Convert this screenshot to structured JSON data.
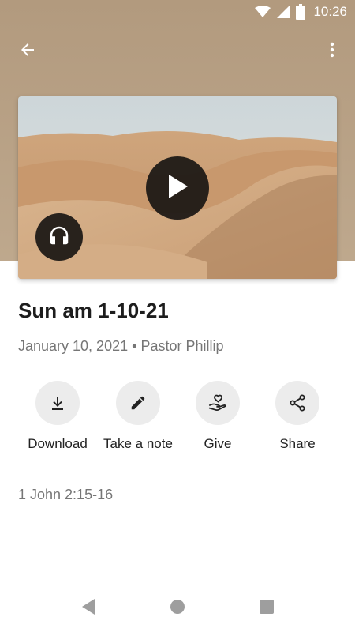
{
  "status_bar": {
    "time": "10:26",
    "icons": [
      "wifi-icon",
      "cell-signal-icon",
      "battery-icon"
    ]
  },
  "app_bar": {
    "back_icon": "arrow-back-icon",
    "menu_icon": "more-vert-icon"
  },
  "media": {
    "play_icon": "play-icon",
    "audio_icon": "headphones-icon"
  },
  "sermon": {
    "title": "Sun am 1-10-21",
    "date": "January 10, 2021",
    "separator": "•",
    "speaker": "Pastor Phillip",
    "scripture": "1 John 2:15-16"
  },
  "actions": [
    {
      "label": "Download",
      "icon": "download-icon"
    },
    {
      "label": "Take a note",
      "icon": "pencil-icon"
    },
    {
      "label": "Give",
      "icon": "give-heart-hand-icon"
    },
    {
      "label": "Share",
      "icon": "share-icon"
    }
  ],
  "colors": {
    "header": "#b29a7e",
    "action_circle": "#ececec",
    "title": "#1d1d1d",
    "meta": "#767676"
  },
  "nav": {
    "icons": [
      "nav-back-icon",
      "nav-home-icon",
      "nav-recents-icon"
    ]
  }
}
